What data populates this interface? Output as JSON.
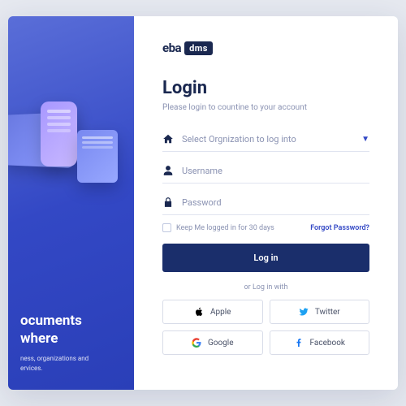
{
  "logo": {
    "part1": "eba",
    "part2": "dms"
  },
  "left_panel": {
    "title": "ocuments\nwhere",
    "subtitle": "ness, organizations and\nervices."
  },
  "login": {
    "title": "Login",
    "subtitle": "Please login to countine to your account",
    "org_placeholder": "Select Orgnization to log into",
    "username_placeholder": "Username",
    "password_placeholder": "Password",
    "keep_logged": "Keep Me logged in for 30 days",
    "forgot": "Forgot Password?",
    "button": "Log in",
    "or_text": "or Log in with",
    "socials": {
      "apple": "Apple",
      "twitter": "Twitter",
      "google": "Google",
      "facebook": "Facebook"
    }
  }
}
